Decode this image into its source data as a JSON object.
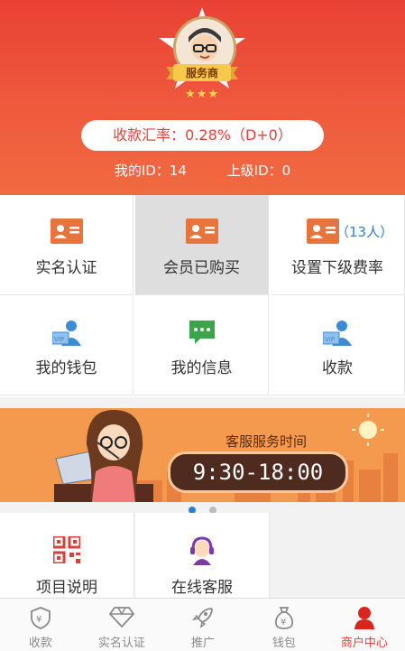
{
  "header": {
    "badge_text": "服务商",
    "stars": "★★★",
    "rate_text": "收款汇率：0.28%（D+0）",
    "my_id": "我的ID：14",
    "parent_id": "上级ID：0"
  },
  "grid": [
    {
      "label": "实名认证",
      "icon": "id-card-icon"
    },
    {
      "label": "会员已购买",
      "icon": "id-card-icon"
    },
    {
      "label": "设置下级费率",
      "icon": "id-card-icon",
      "count": "（13人）"
    },
    {
      "label": "我的钱包",
      "icon": "user-card-icon"
    },
    {
      "label": "我的信息",
      "icon": "chat-bubble-icon"
    },
    {
      "label": "收款",
      "icon": "user-card-icon"
    }
  ],
  "banner": {
    "title": "客服服务时间",
    "time": "9:30-18:00"
  },
  "grid2": [
    {
      "label": "项目说明",
      "icon": "qr-code-icon"
    },
    {
      "label": "在线客服",
      "icon": "headset-agent-icon"
    }
  ],
  "tabs": [
    {
      "label": "收款",
      "icon": "shield-icon"
    },
    {
      "label": "实名认证",
      "icon": "diamond-icon"
    },
    {
      "label": "推广",
      "icon": "rocket-icon"
    },
    {
      "label": "钱包",
      "icon": "money-bag-icon"
    },
    {
      "label": "商户中心",
      "icon": "person-icon",
      "active": true
    }
  ],
  "colors": {
    "brand": "#e94135",
    "accent": "#f06a40",
    "link": "#2d7fd0"
  }
}
